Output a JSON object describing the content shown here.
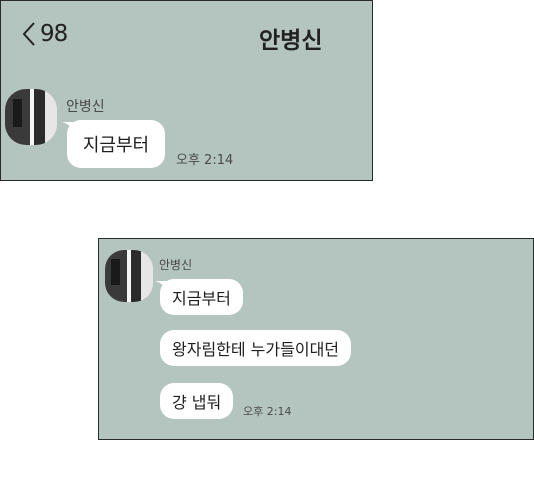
{
  "top_panel": {
    "header": {
      "back_count": "98",
      "title": "안병신"
    },
    "message": {
      "sender": "안병신",
      "text": "지금부터",
      "time": "오후 2:14"
    }
  },
  "bottom_panel": {
    "sender": "안병신",
    "messages": [
      {
        "text": "지금부터"
      },
      {
        "text": "왕자림한테 누가들이대던"
      },
      {
        "text": "걍 냅둬"
      }
    ],
    "time": "오후 2:14"
  },
  "colors": {
    "chat_background": "#b4c4bf",
    "bubble": "#ffffff",
    "border": "#2a2a2a"
  }
}
